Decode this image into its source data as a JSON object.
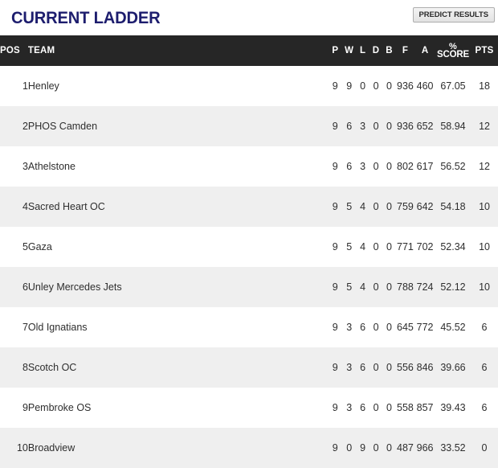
{
  "header": {
    "title": "CURRENT LADDER",
    "predict_button_label": "PREDICT RESULTS"
  },
  "table": {
    "columns": {
      "pos": "POS",
      "team": "TEAM",
      "p": "P",
      "w": "W",
      "l": "L",
      "d": "D",
      "b": "B",
      "f": "F",
      "a": "A",
      "pct_symbol": "%",
      "pct_word": "SCORE",
      "pts": "PTS"
    },
    "rows": [
      {
        "pos": "1",
        "team": "Henley",
        "p": "9",
        "w": "9",
        "l": "0",
        "d": "0",
        "b": "0",
        "f": "936",
        "a": "460",
        "pct": "67.05",
        "pts": "18"
      },
      {
        "pos": "2",
        "team": "PHOS Camden",
        "p": "9",
        "w": "6",
        "l": "3",
        "d": "0",
        "b": "0",
        "f": "936",
        "a": "652",
        "pct": "58.94",
        "pts": "12"
      },
      {
        "pos": "3",
        "team": "Athelstone",
        "p": "9",
        "w": "6",
        "l": "3",
        "d": "0",
        "b": "0",
        "f": "802",
        "a": "617",
        "pct": "56.52",
        "pts": "12"
      },
      {
        "pos": "4",
        "team": "Sacred Heart OC",
        "p": "9",
        "w": "5",
        "l": "4",
        "d": "0",
        "b": "0",
        "f": "759",
        "a": "642",
        "pct": "54.18",
        "pts": "10"
      },
      {
        "pos": "5",
        "team": "Gaza",
        "p": "9",
        "w": "5",
        "l": "4",
        "d": "0",
        "b": "0",
        "f": "771",
        "a": "702",
        "pct": "52.34",
        "pts": "10"
      },
      {
        "pos": "6",
        "team": "Unley Mercedes Jets",
        "p": "9",
        "w": "5",
        "l": "4",
        "d": "0",
        "b": "0",
        "f": "788",
        "a": "724",
        "pct": "52.12",
        "pts": "10"
      },
      {
        "pos": "7",
        "team": "Old Ignatians",
        "p": "9",
        "w": "3",
        "l": "6",
        "d": "0",
        "b": "0",
        "f": "645",
        "a": "772",
        "pct": "45.52",
        "pts": "6"
      },
      {
        "pos": "8",
        "team": "Scotch OC",
        "p": "9",
        "w": "3",
        "l": "6",
        "d": "0",
        "b": "0",
        "f": "556",
        "a": "846",
        "pct": "39.66",
        "pts": "6"
      },
      {
        "pos": "9",
        "team": "Pembroke OS",
        "p": "9",
        "w": "3",
        "l": "6",
        "d": "0",
        "b": "0",
        "f": "558",
        "a": "857",
        "pct": "39.43",
        "pts": "6"
      },
      {
        "pos": "10",
        "team": "Broadview",
        "p": "9",
        "w": "0",
        "l": "9",
        "d": "0",
        "b": "0",
        "f": "487",
        "a": "966",
        "pct": "33.52",
        "pts": "0"
      }
    ]
  },
  "colors": {
    "title": "#1d1d6e",
    "header_bar": "#262626",
    "row_alt": "#efefef",
    "row_base": "#ffffff"
  }
}
